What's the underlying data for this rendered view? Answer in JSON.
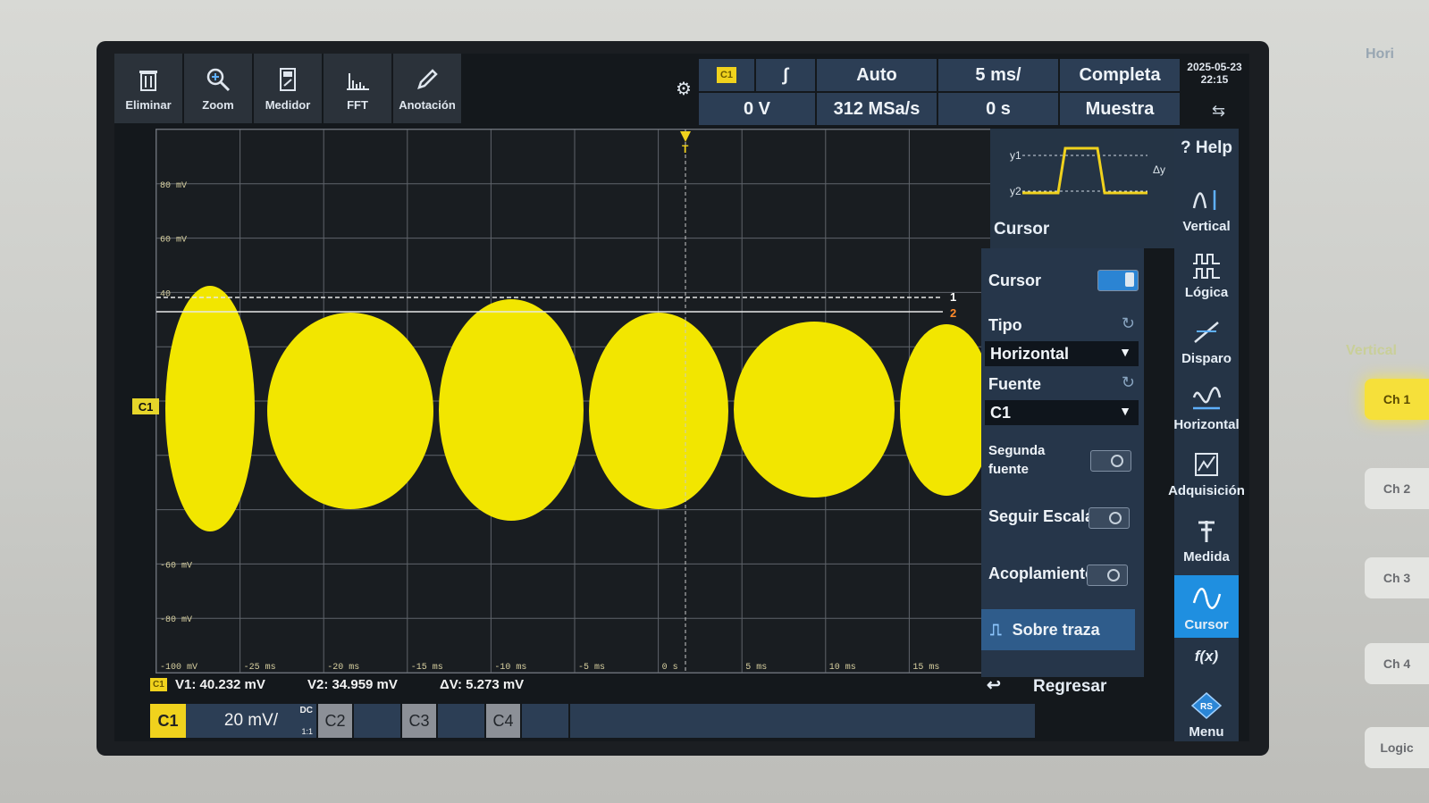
{
  "toolbar": {
    "items": [
      {
        "label": "Eliminar",
        "icon": "trash-icon"
      },
      {
        "label": "Zoom",
        "icon": "zoom-icon"
      },
      {
        "label": "Medidor",
        "icon": "meter-icon"
      },
      {
        "label": "FFT",
        "icon": "fft-icon"
      },
      {
        "label": "Anotación",
        "icon": "pencil-icon"
      }
    ]
  },
  "status": {
    "channel": "C1",
    "slope": "∫",
    "mode": "Auto",
    "timebase": "5 ms/",
    "acquire": "Completa",
    "trigger_level": "0 V",
    "sample_rate": "312 MSa/s",
    "offset": "0 s",
    "sample_mode": "Muestra",
    "date": "2025-05-23",
    "time": "22:15"
  },
  "plot": {
    "y_labels": [
      "80 mV",
      "60 mV",
      "40",
      "-60 mV",
      "-80 mV",
      "-100 mV"
    ],
    "x_labels": [
      "-25 ms",
      "-20 ms",
      "-15 ms",
      "-10 ms",
      "-5 ms",
      "0 s",
      "5 ms",
      "10 ms",
      "15 ms"
    ],
    "cursor1_label": "1",
    "cursor2_label": "2",
    "trigger_marker": "T",
    "channel_marker": "C1",
    "trace_color": "#f2e600"
  },
  "cursor_panel": {
    "title": "Cursor",
    "y1": "y1",
    "y2": "y2",
    "dy": "Δy"
  },
  "menu": {
    "cursor_label": "Cursor",
    "tipo_label": "Tipo",
    "tipo_value": "Horizontal",
    "fuente_label": "Fuente",
    "fuente_value": "C1",
    "segunda_label_1": "Segunda",
    "segunda_label_2": "fuente",
    "seguir_label": "Seguir Escala",
    "acoplamiento_label": "Acoplamiento",
    "sobre_label": "Sobre traza",
    "regresar_label": "Regresar"
  },
  "rightcol": {
    "help": "Help",
    "items": [
      "Vertical",
      "Lógica",
      "Disparo",
      "Horizontal",
      "Adquisición",
      "Medida",
      "Cursor"
    ],
    "fx": "f(x)",
    "menu": "Menu"
  },
  "readout": {
    "channel": "C1",
    "v1": "V1: 40.232 mV",
    "v2": "V2: 34.959 mV",
    "dv": "ΔV: 5.273 mV"
  },
  "channels": {
    "c1": "C1",
    "c1_scale": "20 mV/",
    "c1_coupling": "DC",
    "c1_ratio": "1:1",
    "c2": "C2",
    "c3": "C3",
    "c4": "C4"
  },
  "physical_buttons": [
    "Ch 1",
    "Ch 2",
    "Ch 3",
    "Ch 4",
    "Logic"
  ],
  "physical_side_labels": {
    "top": "Hori",
    "vertical": "Vertical"
  }
}
